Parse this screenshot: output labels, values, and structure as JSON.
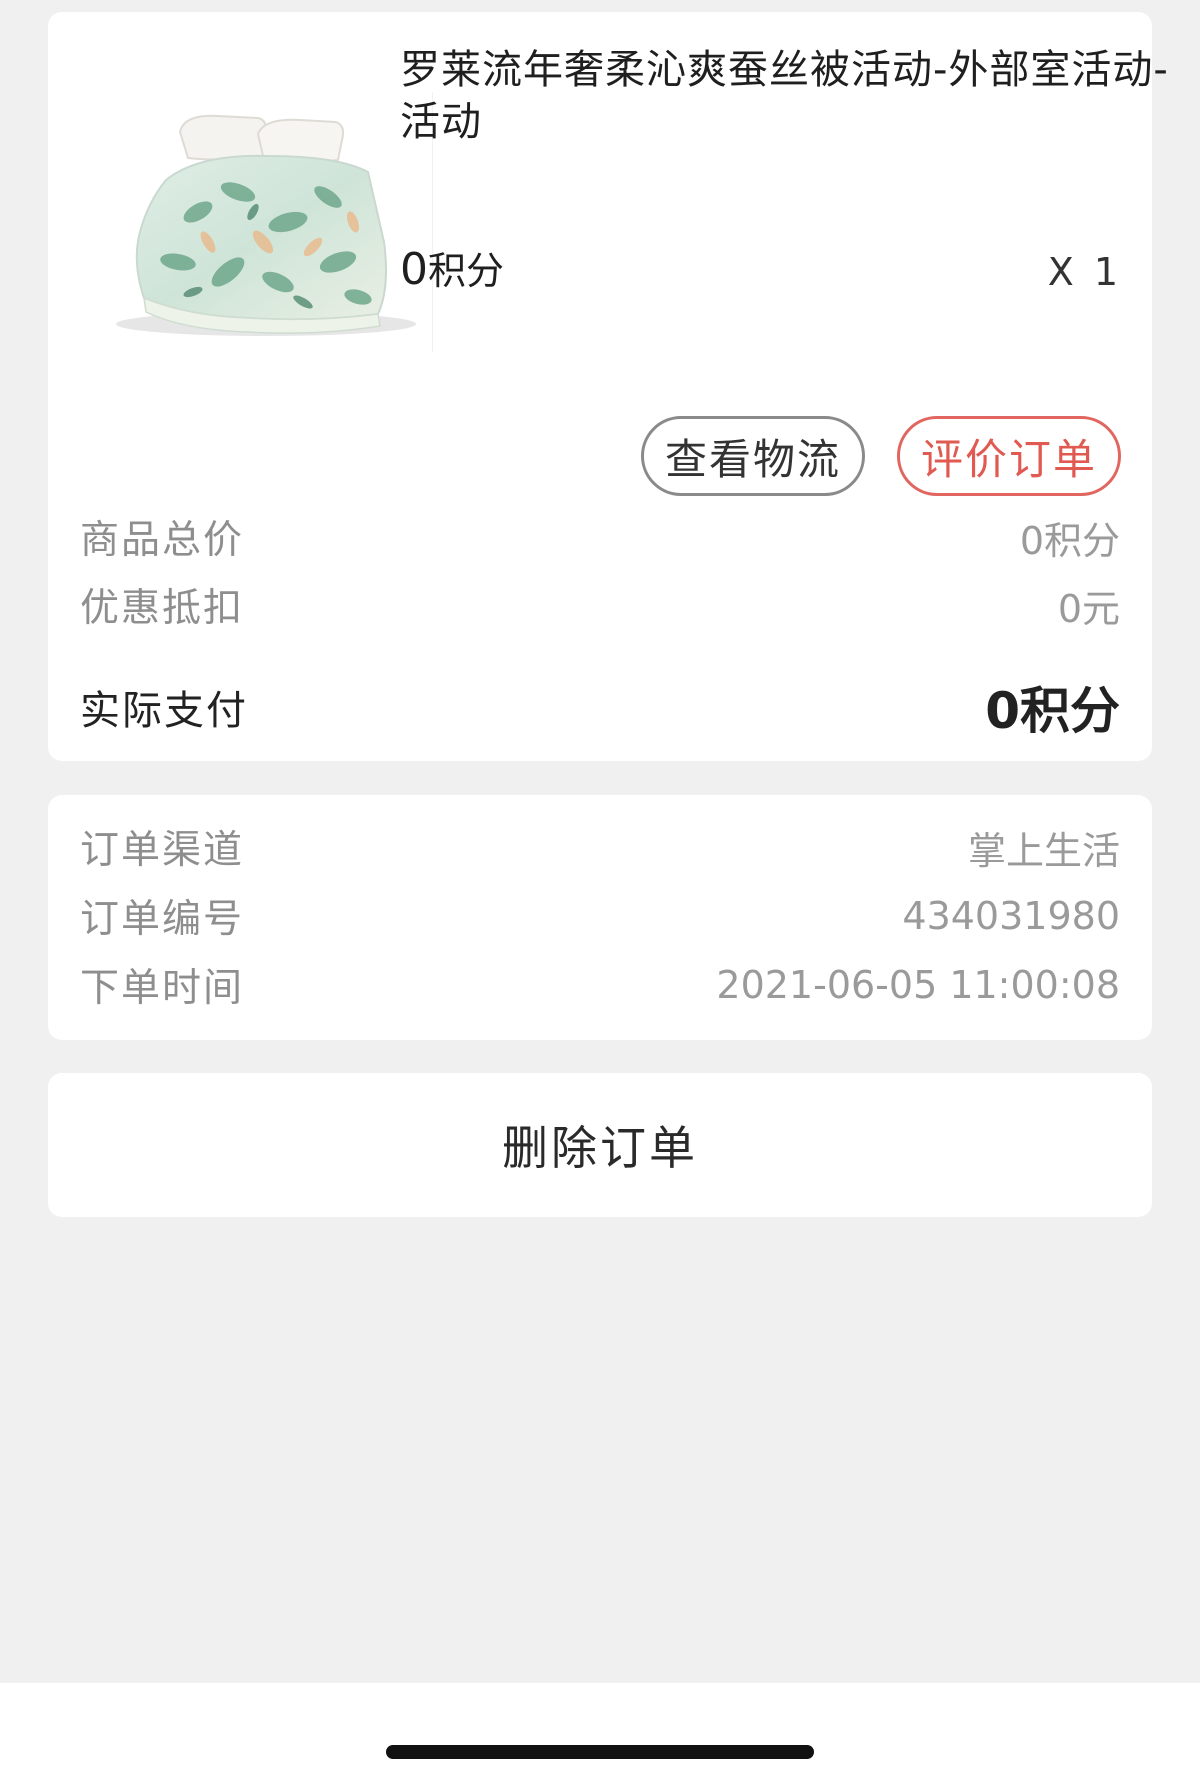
{
  "product": {
    "title": "罗莱流年奢柔沁爽蚕丝被活动-外部室活动-活动",
    "price_num": "0",
    "price_unit": "积分",
    "quantity": "X 1",
    "image_icon": "bedding-product-image"
  },
  "actions": {
    "logistics_label": "查看物流",
    "review_label": "评价订单"
  },
  "summary": {
    "total_label": "商品总价",
    "total_value": "0积分",
    "discount_label": "优惠抵扣",
    "discount_value": "0元",
    "paid_label": "实际支付",
    "paid_value": "0积分"
  },
  "order_info": {
    "channel_label": "订单渠道",
    "channel_value": "掌上生活",
    "number_label": "订单编号",
    "number_value": "434031980",
    "time_label": "下单时间",
    "time_value": "2021-06-05 11:00:08"
  },
  "delete": {
    "label": "删除订单"
  },
  "colors": {
    "background": "#f0f0f0",
    "card": "#ffffff",
    "accent_red": "#e05a52",
    "text_dark": "#222222",
    "text_grey": "#8e8e8e"
  }
}
